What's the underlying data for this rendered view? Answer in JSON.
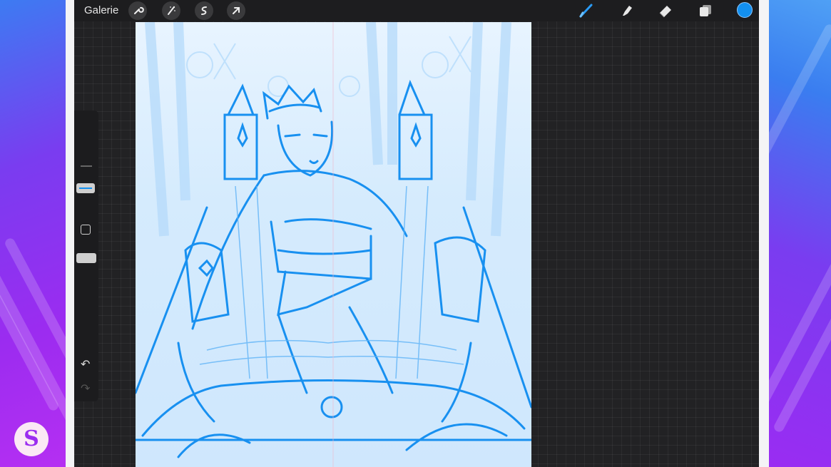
{
  "topbar": {
    "gallery_label": "Galerie",
    "left_tools": [
      {
        "icon": "wrench-icon",
        "glyph": "🔧"
      },
      {
        "icon": "magic-wand-icon",
        "glyph": "✧"
      },
      {
        "icon": "selection-icon",
        "glyph": "S"
      },
      {
        "icon": "transform-arrow-icon",
        "glyph": "➚"
      }
    ],
    "right_tools": [
      {
        "icon": "brush-icon"
      },
      {
        "icon": "smudge-icon"
      },
      {
        "icon": "eraser-icon"
      },
      {
        "icon": "layers-icon"
      }
    ],
    "color": "#1390f0"
  },
  "sidebar": {
    "undo_glyph": "↶",
    "redo_glyph": "↷"
  },
  "logo_letter": "S",
  "colors": {
    "sketch": "#1890f0",
    "canvas_bg": "#e8f4ff",
    "app_bg": "#222224"
  }
}
